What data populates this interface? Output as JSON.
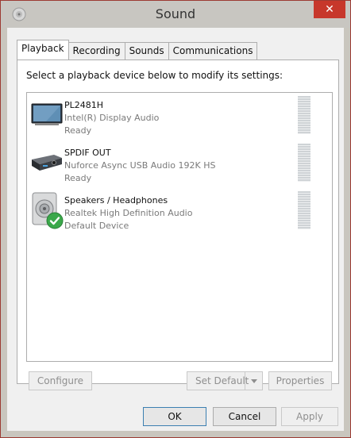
{
  "window": {
    "title": "Sound",
    "close_label": "✕"
  },
  "tabs": [
    {
      "label": "Playback",
      "active": true
    },
    {
      "label": "Recording",
      "active": false
    },
    {
      "label": "Sounds",
      "active": false
    },
    {
      "label": "Communications",
      "active": false
    }
  ],
  "instruction": "Select a playback device below to modify its settings:",
  "devices": [
    {
      "name": "PL2481H",
      "description": "Intel(R) Display Audio",
      "status": "Ready",
      "icon": "monitor-icon"
    },
    {
      "name": "SPDIF OUT",
      "description": "Nuforce Async USB Audio 192K HS",
      "status": "Ready",
      "icon": "audio-device-icon"
    },
    {
      "name": "Speakers / Headphones",
      "description": "Realtek High Definition Audio",
      "status": "Default Device",
      "icon": "speaker-icon"
    }
  ],
  "buttons": {
    "configure": "Configure",
    "set_default": "Set Default",
    "properties": "Properties",
    "ok": "OK",
    "cancel": "Cancel",
    "apply": "Apply"
  },
  "colors": {
    "close": "#c7372b",
    "default_check": "#3aa84a",
    "ok_border": "#3c7fb1"
  }
}
